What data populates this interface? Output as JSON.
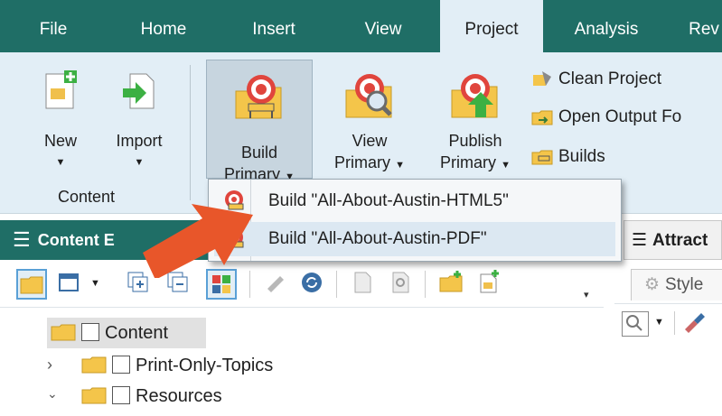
{
  "ribbon": {
    "tabs": [
      {
        "label": "File"
      },
      {
        "label": "Home"
      },
      {
        "label": "Insert"
      },
      {
        "label": "View"
      },
      {
        "label": "Project",
        "active": true
      },
      {
        "label": "Analysis"
      },
      {
        "label": "Rev"
      }
    ],
    "buttons": {
      "new": {
        "label": "New"
      },
      "import": {
        "label": "Import"
      },
      "build_primary": {
        "line1": "Build",
        "line2": "Primary"
      },
      "view_primary": {
        "line1": "View",
        "line2": "Primary"
      },
      "publish_primary": {
        "line1": "Publish",
        "line2": "Primary"
      }
    },
    "small_items": [
      "Clean Project",
      "Open Output Fo",
      "Builds"
    ],
    "group_label": "Content"
  },
  "dropdown": {
    "items": [
      {
        "label": "Build \"All-About-Austin-HTML5\""
      },
      {
        "label": "Build \"All-About-Austin-PDF\""
      }
    ]
  },
  "content_explorer": {
    "title": "Content E",
    "tree": [
      {
        "label": "Content"
      },
      {
        "label": "Print-Only-Topics"
      },
      {
        "label": "Resources"
      }
    ]
  },
  "right_panel": {
    "title": "Attract",
    "tab": "Style"
  },
  "colors": {
    "ribbon_tabbar": "#1f6e66",
    "ribbon_body": "#e2eef6",
    "annotation_arrow": "#e8562a",
    "target_red": "#e0453d",
    "folder_yellow": "#f4c54a"
  }
}
